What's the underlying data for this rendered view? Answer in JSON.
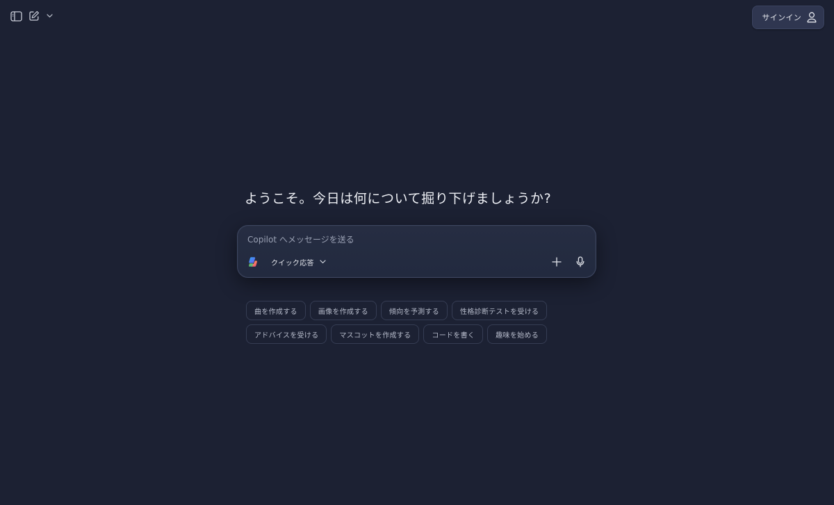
{
  "header": {
    "signin_label": "サインイン",
    "icons": [
      "sidebar-toggle-icon",
      "new-chat-icon",
      "chevron-down-icon",
      "user-icon"
    ]
  },
  "main": {
    "headline": "ようこそ。今日は何について掘り下げましょうか?",
    "composer": {
      "placeholder": "Copilot へメッセージを送る",
      "value": "",
      "mode_label": "クイック応答",
      "icons": [
        "copilot-logo-icon",
        "chevron-down-icon",
        "plus-icon",
        "microphone-icon"
      ]
    },
    "suggestions": [
      [
        "曲を作成する",
        "画像を作成する",
        "傾向を予測する",
        "性格診断テストを受ける"
      ],
      [
        "アドバイスを受ける",
        "マスコットを作成する",
        "コードを書く",
        "趣味を始める"
      ]
    ]
  },
  "colors": {
    "background": "#1c2133",
    "composer_bg": "#262d42",
    "signin_bg": "#2f3650",
    "chip_border": "#363d54",
    "text_primary": "#e6e8ee",
    "text_muted": "#b7bccb"
  }
}
